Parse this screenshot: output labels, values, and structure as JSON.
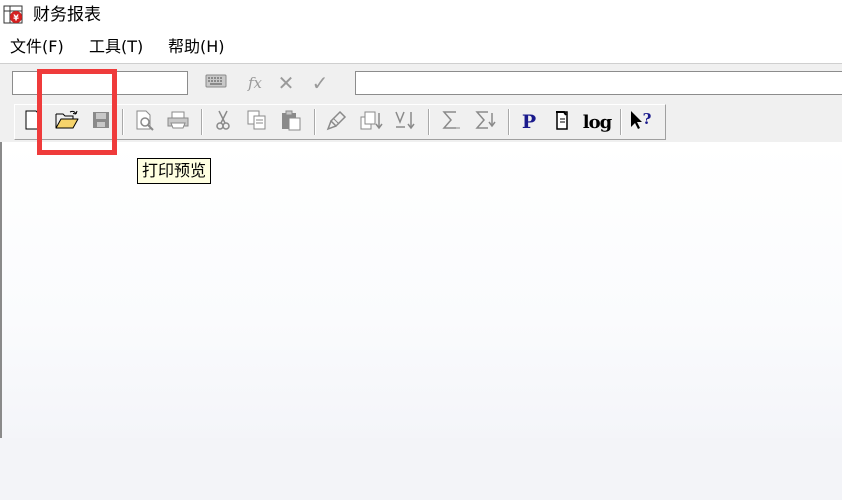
{
  "window": {
    "title": "财务报表",
    "app_icon": "financial-report-app-icon"
  },
  "menu": [
    {
      "label": "文件(F)"
    },
    {
      "label": "工具(T)"
    },
    {
      "label": "帮助(H)"
    }
  ],
  "formula_bar": {
    "cell_reference": "",
    "formula": "",
    "buttons": [
      {
        "name": "keyboard-icon"
      },
      {
        "name": "function-icon",
        "glyph": "fx"
      },
      {
        "name": "cancel-icon",
        "glyph": "✕"
      },
      {
        "name": "confirm-icon",
        "glyph": "✓"
      }
    ]
  },
  "toolbar": {
    "buttons": [
      "new-icon",
      "open-folder-icon",
      "save-icon",
      "print-preview-icon",
      "print-icon",
      "cut-icon",
      "copy-icon",
      "paste-icon",
      "format-painter-icon",
      "sort-ascending-icon",
      "sort-descending-icon",
      "sum-icon",
      "sum-select-icon",
      "property-icon",
      "document-icon",
      "log-icon",
      "help-pointer-icon"
    ],
    "property_label": "P",
    "log_label": "log"
  },
  "tooltip": {
    "text": "打印预览"
  },
  "colors": {
    "highlight": "#ef3b3b",
    "tooltip_bg": "#ffffe1",
    "toolbar_bg": "#f0f0f0",
    "bold_blue": "#1a1a8c"
  }
}
